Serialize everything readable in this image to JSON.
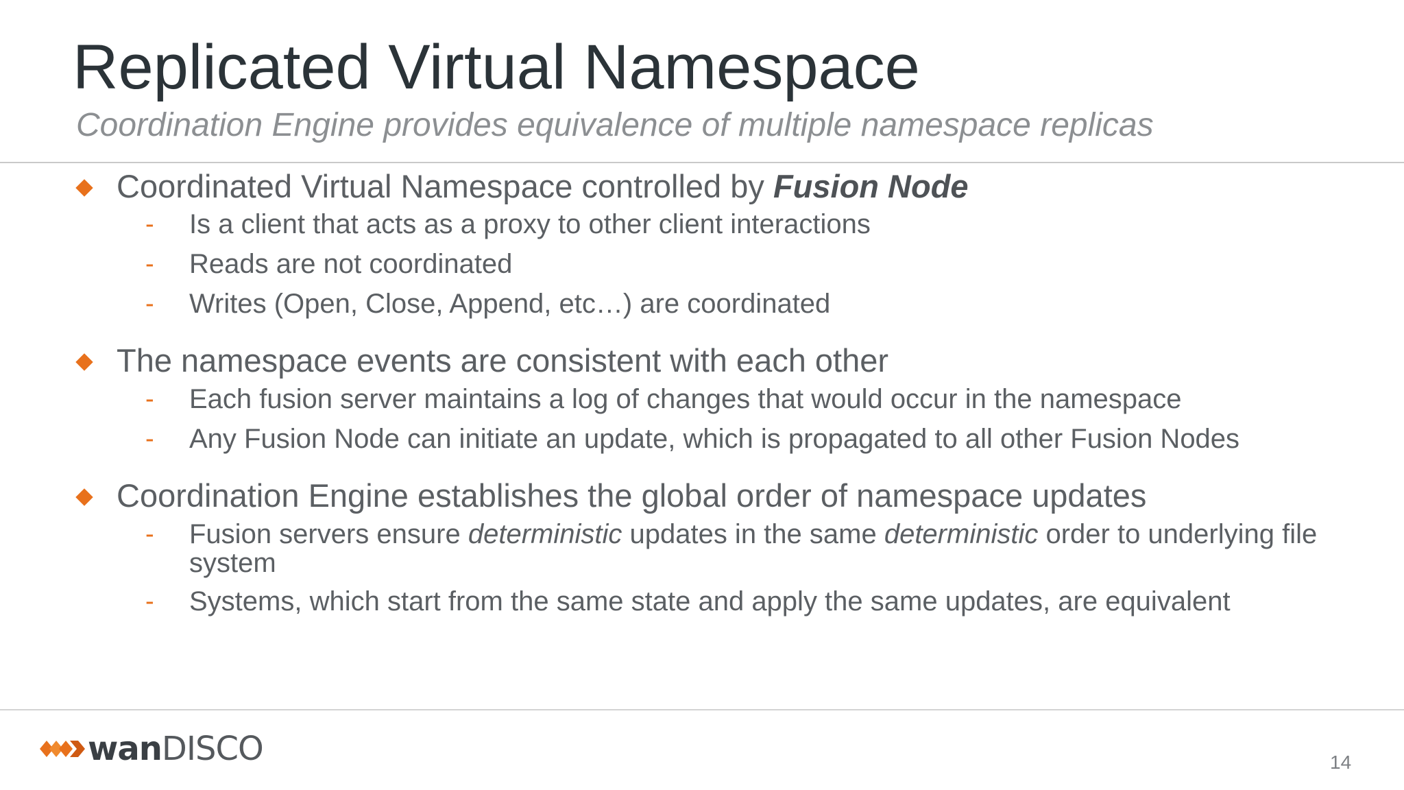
{
  "slide": {
    "title": "Replicated Virtual Namespace",
    "subtitle": "Coordination Engine provides equivalence of multiple namespace replicas",
    "page_number": "14"
  },
  "bullets": [
    {
      "text_prefix": "Coordinated Virtual Namespace controlled by ",
      "text_bold": "Fusion Node",
      "subs": [
        "Is a client that acts as a proxy to other client interactions",
        "Reads are not coordinated",
        "Writes (Open, Close, Append, etc…) are coordinated"
      ]
    },
    {
      "text": "The namespace events are consistent with each other",
      "subs": [
        "Each fusion server maintains a log of changes that would occur in the namespace",
        "Any Fusion Node can initiate an update, which is propagated to all other Fusion Nodes"
      ]
    },
    {
      "text": "Coordination Engine establishes the global order of namespace updates",
      "sub_rich": {
        "part1": "Fusion servers ensure ",
        "em1": "deterministic",
        "part2": " updates in the same ",
        "em2": "deterministic",
        "part3": " order to underlying file system"
      },
      "subs": [
        "Systems, which start from the same state and apply the same updates, are equivalent"
      ]
    }
  ],
  "sub_marker": "-",
  "footer": {
    "logo_bold": "wan",
    "logo_light": "DISCO",
    "logo_icon": "wandisco-arrows-icon"
  },
  "colors": {
    "accent": "#e8711c",
    "title": "#2b3338",
    "body": "#5b5f63",
    "subtitle": "#8c8f92"
  }
}
